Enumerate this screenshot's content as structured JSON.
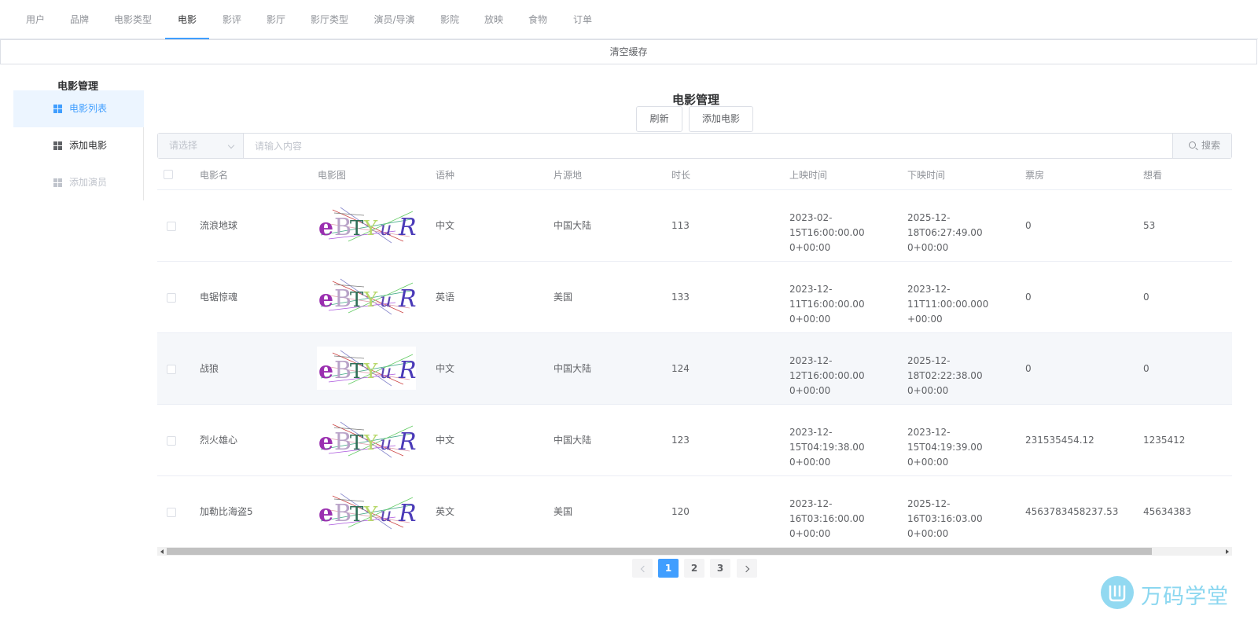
{
  "nav": {
    "tabs": [
      "用户",
      "品牌",
      "电影类型",
      "电影",
      "影评",
      "影厅",
      "影厅类型",
      "演员/导演",
      "影院",
      "放映",
      "食物",
      "订单"
    ],
    "active_index": 3
  },
  "cache_button": "清空缓存",
  "sidebar": {
    "title": "电影管理",
    "items": [
      {
        "label": "电影列表",
        "state": "active"
      },
      {
        "label": "添加电影",
        "state": "normal"
      },
      {
        "label": "添加演员",
        "state": "disabled"
      }
    ]
  },
  "main": {
    "title": "电影管理",
    "refresh_label": "刷新",
    "add_label": "添加电影"
  },
  "search": {
    "select_placeholder": "请选择",
    "input_placeholder": "请输入内容",
    "button_label": "搜索"
  },
  "table": {
    "columns": [
      "电影名",
      "电影图",
      "语种",
      "片源地",
      "时长",
      "上映时间",
      "下映时间",
      "票房",
      "想看"
    ],
    "rows": [
      {
        "name": "流浪地球",
        "language": "中文",
        "origin": "中国大陆",
        "duration": "113",
        "release_1": "2023-02-15T16:00:00.00",
        "release_2": "0+00:00",
        "off_1": "2025-12-18T06:27:49.00",
        "off_2": "0+00:00",
        "box_office": "0",
        "want": "53"
      },
      {
        "name": "电锯惊魂",
        "language": "英语",
        "origin": "美国",
        "duration": "133",
        "release_1": "2023-12-11T16:00:00.00",
        "release_2": "0+00:00",
        "off_1": "2023-12-11T11:00:00.000",
        "off_2": "+00:00",
        "box_office": "0",
        "want": "0"
      },
      {
        "name": "战狼",
        "language": "中文",
        "origin": "中国大陆",
        "duration": "124",
        "release_1": "2023-12-12T16:00:00.00",
        "release_2": "0+00:00",
        "off_1": "2025-12-18T02:22:38.00",
        "off_2": "0+00:00",
        "box_office": "0",
        "want": "0"
      },
      {
        "name": "烈火雄心",
        "language": "中文",
        "origin": "中国大陆",
        "duration": "123",
        "release_1": "2023-12-15T04:19:38.00",
        "release_2": "0+00:00",
        "off_1": "2023-12-15T04:19:39.00",
        "off_2": "0+00:00",
        "box_office": "231535454.12",
        "want": "1235412"
      },
      {
        "name": "加勒比海盗5",
        "language": "英文",
        "origin": "美国",
        "duration": "120",
        "release_1": "2023-12-16T03:16:00.00",
        "release_2": "0+00:00",
        "off_1": "2025-12-16T03:16:03.00",
        "off_2": "0+00:00",
        "box_office": "4563783458237.53",
        "want": "45634383"
      }
    ],
    "hover_row": 2
  },
  "captcha": {
    "chars": [
      "e",
      "B",
      "T",
      "Y",
      "u",
      "R"
    ],
    "colors": [
      "#9a2fb0",
      "#b9a3c8",
      "#2f6f57",
      "#b7d86a",
      "#5a44b3",
      "#4a3ab8"
    ]
  },
  "pagination": {
    "pages": [
      "1",
      "2",
      "3"
    ],
    "current": "1"
  },
  "watermark": "万码学堂",
  "colors": {
    "accent": "#409eff",
    "hover_row": "#f5f7fa",
    "active_sidebar_bg": "#ecf5ff"
  }
}
